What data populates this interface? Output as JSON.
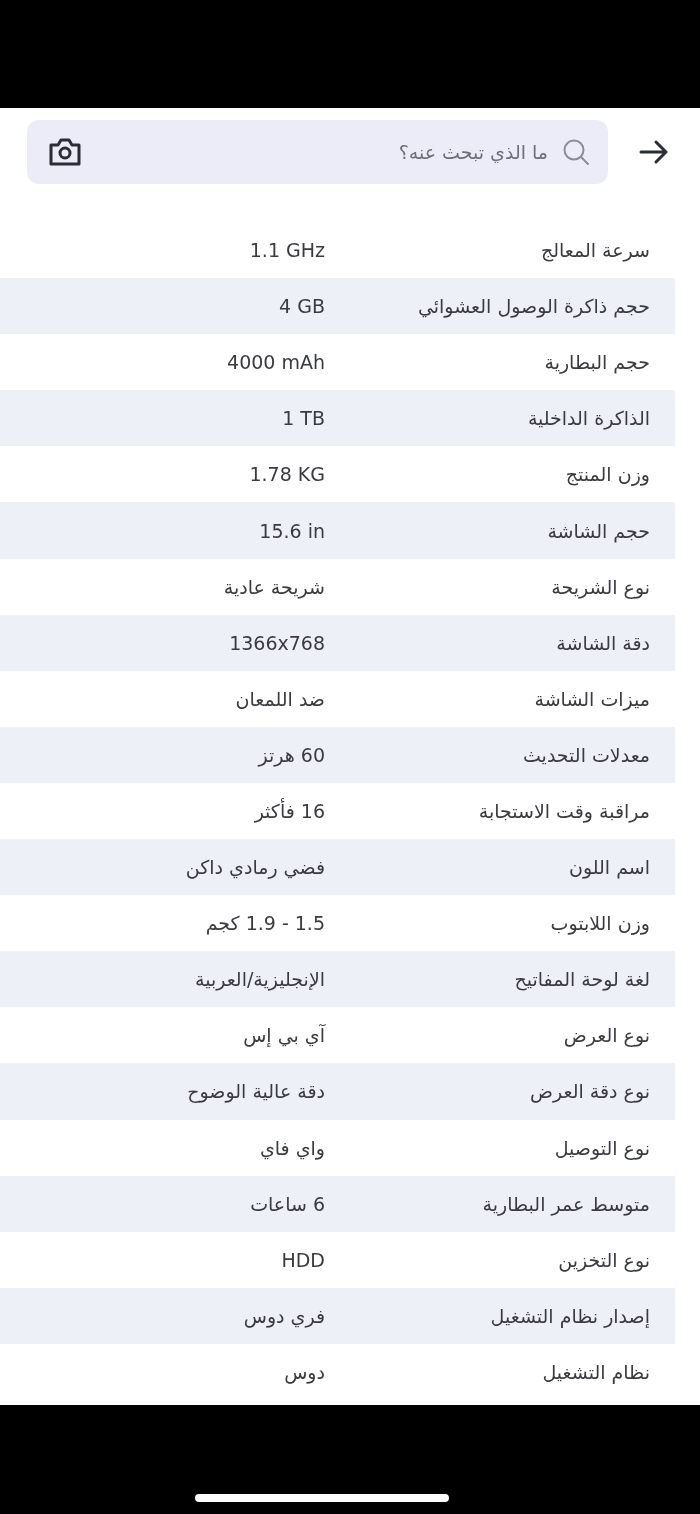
{
  "search": {
    "placeholder": "ما الذي تبحث عنه؟"
  },
  "specs": [
    {
      "label": "سرعة المعالج",
      "value": "1.1 GHz"
    },
    {
      "label": "حجم ذاكرة الوصول العشوائي",
      "value": "4 GB"
    },
    {
      "label": "حجم البطارية",
      "value": "4000 mAh"
    },
    {
      "label": "الذاكرة الداخلية",
      "value": "1 TB"
    },
    {
      "label": "وزن المنتج",
      "value": "1.78 KG"
    },
    {
      "label": "حجم الشاشة",
      "value": "15.6 in"
    },
    {
      "label": "نوع الشريحة",
      "value": "شريحة عادية"
    },
    {
      "label": "دقة الشاشة",
      "value": "1366x768"
    },
    {
      "label": "ميزات الشاشة",
      "value": "ضد اللمعان"
    },
    {
      "label": "معدلات التحديث",
      "value": "60 هرتز"
    },
    {
      "label": "مراقبة وقت الاستجابة",
      "value": "16 فأكثر"
    },
    {
      "label": "اسم اللون",
      "value": "فضي رمادي داكن"
    },
    {
      "label": "وزن اللابتوب",
      "value": "1.5 - 1.9 كجم"
    },
    {
      "label": "لغة لوحة المفاتيح",
      "value": "الإنجليزية/العربية"
    },
    {
      "label": "نوع العرض",
      "value": "آي بي إس"
    },
    {
      "label": "نوع دقة العرض",
      "value": "دقة عالية الوضوح"
    },
    {
      "label": "نوع التوصيل",
      "value": "واي فاي"
    },
    {
      "label": "متوسط عمر البطارية",
      "value": "6 ساعات"
    },
    {
      "label": "نوع التخزين",
      "value": "HDD"
    },
    {
      "label": "إصدار نظام التشغيل",
      "value": "فري دوس"
    },
    {
      "label": "نظام التشغيل",
      "value": "دوس"
    }
  ]
}
